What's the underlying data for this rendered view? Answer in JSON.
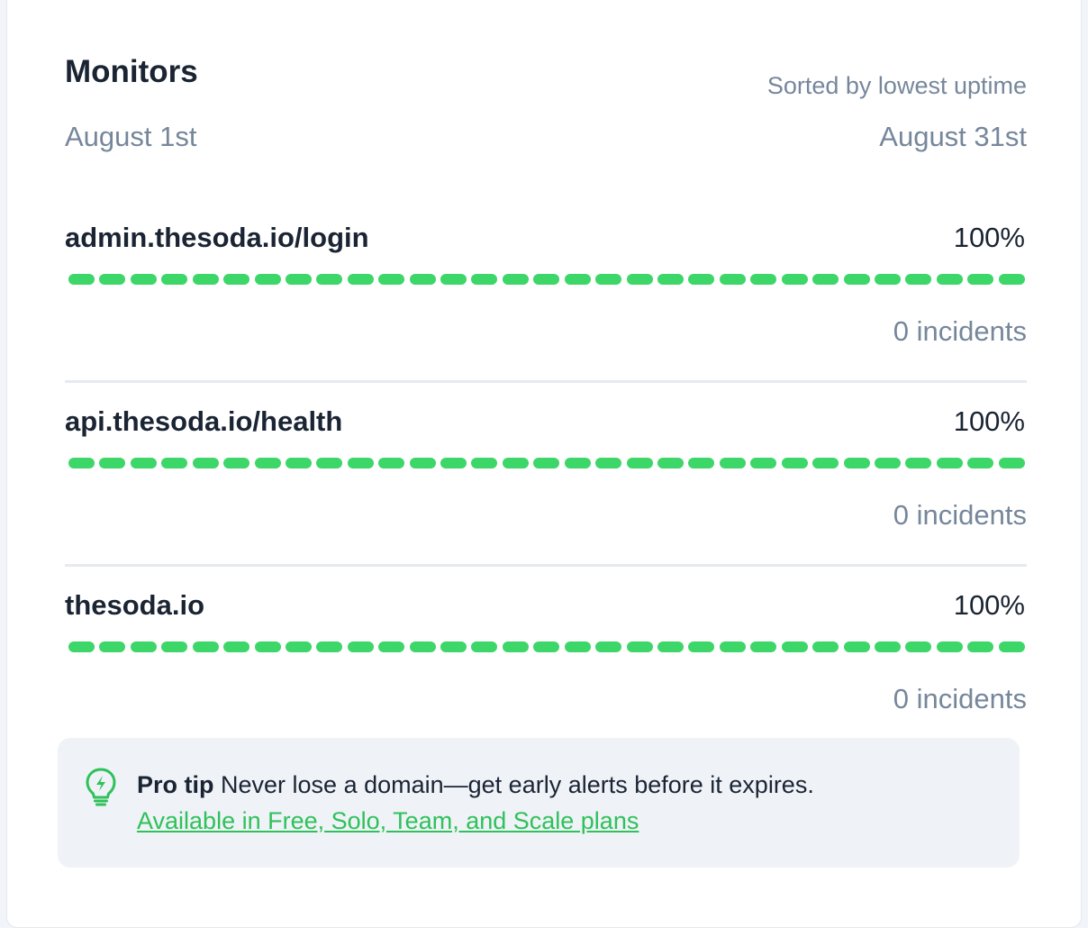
{
  "header": {
    "title": "Monitors",
    "sort_label": "Sorted by lowest uptime"
  },
  "range": {
    "start": "August 1st",
    "end": "August 31st"
  },
  "monitors": [
    {
      "name": "admin.thesoda.io/login",
      "uptime": "100%",
      "incidents": "0 incidents",
      "days_up": 31
    },
    {
      "name": "api.thesoda.io/health",
      "uptime": "100%",
      "incidents": "0 incidents",
      "days_up": 31
    },
    {
      "name": "thesoda.io",
      "uptime": "100%",
      "incidents": "0 incidents",
      "days_up": 31
    }
  ],
  "tip": {
    "label": "Pro tip",
    "text": "Never lose a domain—get early alerts before it expires.",
    "link": "Available in Free, Solo, Team, and Scale plans",
    "icon": "lightbulb-icon"
  },
  "colors": {
    "up": "#3dd668",
    "link": "#2fc15a",
    "muted": "#76879b",
    "text": "#1a2433"
  }
}
